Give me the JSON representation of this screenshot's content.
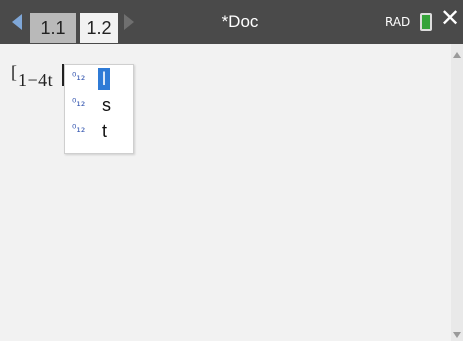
{
  "header": {
    "tabs": [
      {
        "label": "1.1"
      },
      {
        "label": "1.2"
      }
    ],
    "doc_title": "*Doc",
    "mode": "RAD"
  },
  "workspace": {
    "expression": "1−4t"
  },
  "autocomplete": {
    "items": [
      {
        "icon": "⁰₁₂",
        "label": "l"
      },
      {
        "icon": "⁰₁₂",
        "label": "s"
      },
      {
        "icon": "⁰₁₂",
        "label": "t"
      }
    ]
  }
}
